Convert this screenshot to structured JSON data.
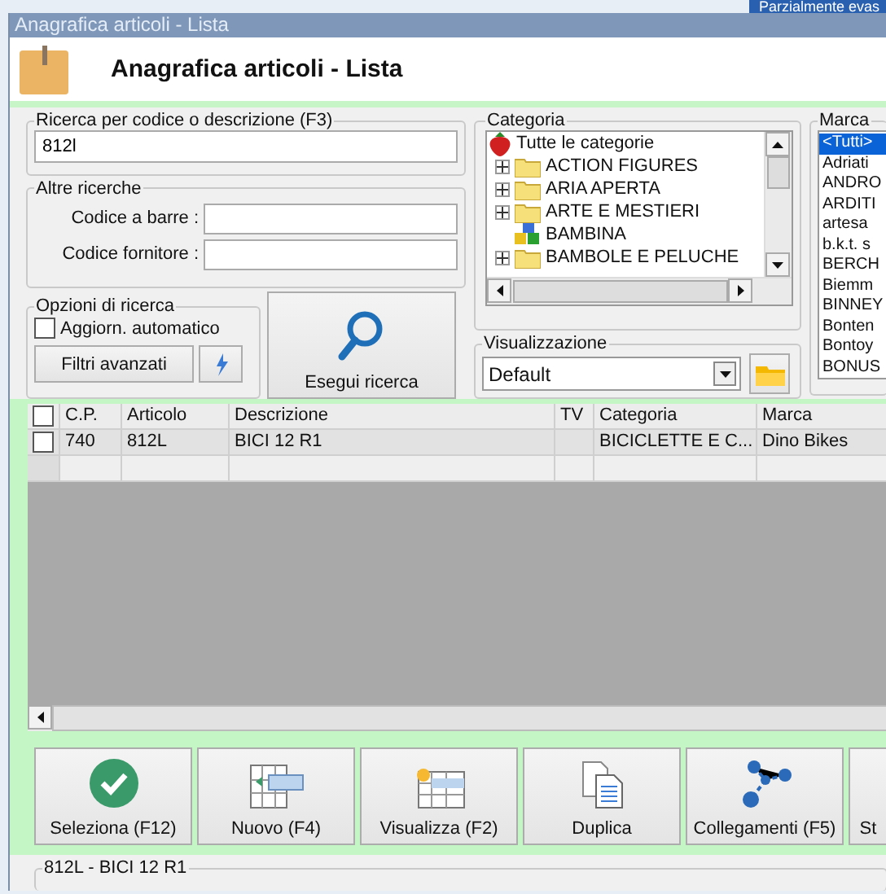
{
  "background_window": {
    "text": "Parzialmente evas"
  },
  "window": {
    "title": "Anagrafica articoli  - Lista",
    "heading": "Anagrafica articoli  - Lista"
  },
  "search": {
    "legend": "Ricerca per codice o descrizione (F3)",
    "value": "812l"
  },
  "other_searches": {
    "legend": "Altre ricerche",
    "fields": [
      {
        "label": "Codice a barre :"
      },
      {
        "label": "Codice fornitore :"
      }
    ]
  },
  "options": {
    "legend": "Opzioni di ricerca",
    "auto_update": {
      "label": "Aggiorn. automatico",
      "checked": false
    },
    "advanced_filters": "Filtri avanzati"
  },
  "run_search_button": "Esegui ricerca",
  "category": {
    "legend": "Categoria",
    "tree": [
      {
        "label": "Tutte le categorie",
        "kind": "root",
        "children": [
          {
            "label": "ACTION FIGURES",
            "kind": "folder",
            "expanded": false
          },
          {
            "label": "ARIA APERTA",
            "kind": "folder",
            "expanded": false
          },
          {
            "label": "ARTE E MESTIERI",
            "kind": "folder",
            "expanded": false
          },
          {
            "label": "BAMBINA",
            "kind": "group"
          },
          {
            "label": "BAMBOLE E PELUCHE",
            "kind": "folder",
            "expanded": false
          }
        ]
      }
    ]
  },
  "view": {
    "legend": "Visualizzazione",
    "value": "Default"
  },
  "brand": {
    "legend": "Marca",
    "items": [
      {
        "label": "<Tutti>",
        "selected": true
      },
      {
        "label": "Adriati",
        "selected": false
      },
      {
        "label": "ANDRO",
        "selected": false
      },
      {
        "label": "ARDITI",
        "selected": false
      },
      {
        "label": "artesa",
        "selected": false
      },
      {
        "label": "b.k.t. s",
        "selected": false
      },
      {
        "label": "BERCH",
        "selected": false
      },
      {
        "label": "Biemm",
        "selected": false
      },
      {
        "label": "BINNEY",
        "selected": false
      },
      {
        "label": "Bonten",
        "selected": false
      },
      {
        "label": "Bontoy",
        "selected": false
      },
      {
        "label": "BONUS",
        "selected": false
      }
    ]
  },
  "table": {
    "header_checked": false,
    "columns": [
      "C.P.",
      "Articolo",
      "Descrizione",
      "TV",
      "Categoria",
      "Marca"
    ],
    "rows": [
      {
        "checked": false,
        "cells": [
          "740",
          "812L",
          "BICI 12 R1",
          null,
          "BICICLETTE E C...",
          "Dino Bikes"
        ]
      }
    ]
  },
  "toolbar": [
    {
      "label": "Seleziona (F12)",
      "kind": "check"
    },
    {
      "label": "Nuovo (F4)",
      "kind": "new"
    },
    {
      "label": "Visualizza (F2)",
      "kind": "view"
    },
    {
      "label": "Duplica",
      "kind": "duplicate"
    },
    {
      "label": "Collegamenti (F5)",
      "kind": "links"
    },
    {
      "label": "St",
      "kind": "none"
    }
  ],
  "detail_group": {
    "legend": "812L - BICI 12 R1"
  }
}
